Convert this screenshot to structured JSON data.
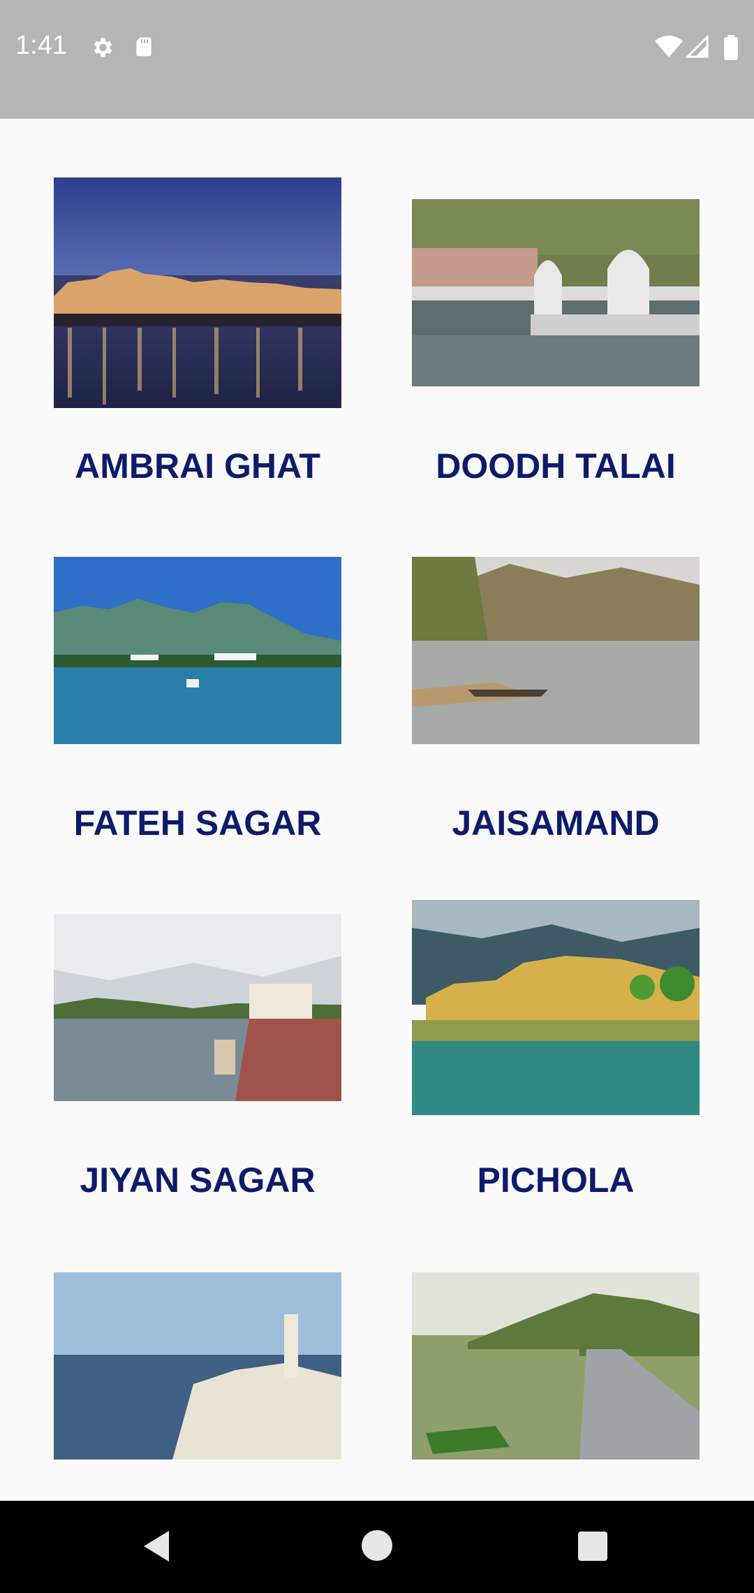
{
  "status_bar": {
    "time": "1:41",
    "icons": [
      "gear-icon",
      "sd-card-icon",
      "wifi-icon",
      "signal-icon",
      "battery-icon"
    ]
  },
  "lakes": [
    {
      "name": "AMBRAI GHAT"
    },
    {
      "name": "DOODH TALAI"
    },
    {
      "name": "FATEH SAGAR"
    },
    {
      "name": "JAISAMAND"
    },
    {
      "name": "JIYAN SAGAR"
    },
    {
      "name": "PICHOLA"
    },
    {
      "name": ""
    },
    {
      "name": ""
    }
  ],
  "nav_bar": {
    "icons": [
      "back-icon",
      "home-icon",
      "recents-icon"
    ]
  },
  "colors": {
    "status_bar": "#b5b5b5",
    "label": "#0d1b6b",
    "background": "#fafafa",
    "nav_bar": "#000000"
  }
}
